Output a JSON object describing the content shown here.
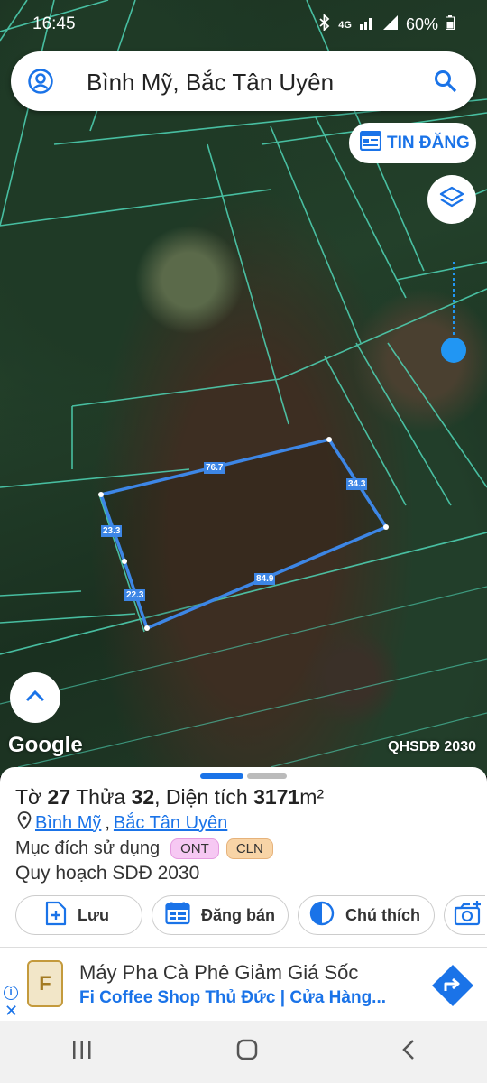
{
  "status": {
    "time": "16:45",
    "net": "4G",
    "battery": "60%"
  },
  "search": {
    "title": "Bình Mỹ, Bắc Tân Uyên"
  },
  "tin_dang": {
    "label": "TIN ĐĂNG"
  },
  "map": {
    "measures": [
      "76.7",
      "34.3",
      "23.3",
      "22.3",
      "84.9"
    ],
    "google": "Google",
    "layer_name": "QHSDĐ 2030"
  },
  "sheet": {
    "to_label": "Tờ",
    "to_num": "27",
    "thua_label": "Thửa",
    "thua_num": "32",
    "dien_tich_label": ", Diện tích",
    "dien_tich": "3171",
    "unit": "m²",
    "commune": "Bình Mỹ",
    "district": "Bắc Tân Uyên",
    "muc_dich_label": "Mục đích sử dụng",
    "badges": [
      {
        "text": "ONT",
        "bg": "#f6c8f3",
        "border": "#e59be0"
      },
      {
        "text": "CLN",
        "bg": "#f8d4a6",
        "border": "#e6b27a"
      }
    ],
    "quy_hoach": "Quy hoạch SDĐ 2030",
    "actions": {
      "luu": "Lưu",
      "dang_ban": "Đăng bán",
      "chu_thich": "Chú thích"
    }
  },
  "ad": {
    "title": "Máy Pha Cà Phê Giảm Giá Sốc",
    "subtitle": "Fi Coffee Shop Thủ Đức | Cửa Hàng...",
    "logo_letter": "F"
  },
  "colors": {
    "accent": "#1a73e8",
    "parcel_outline": "#3d86e6",
    "cadastral": "#4fd6b7"
  }
}
